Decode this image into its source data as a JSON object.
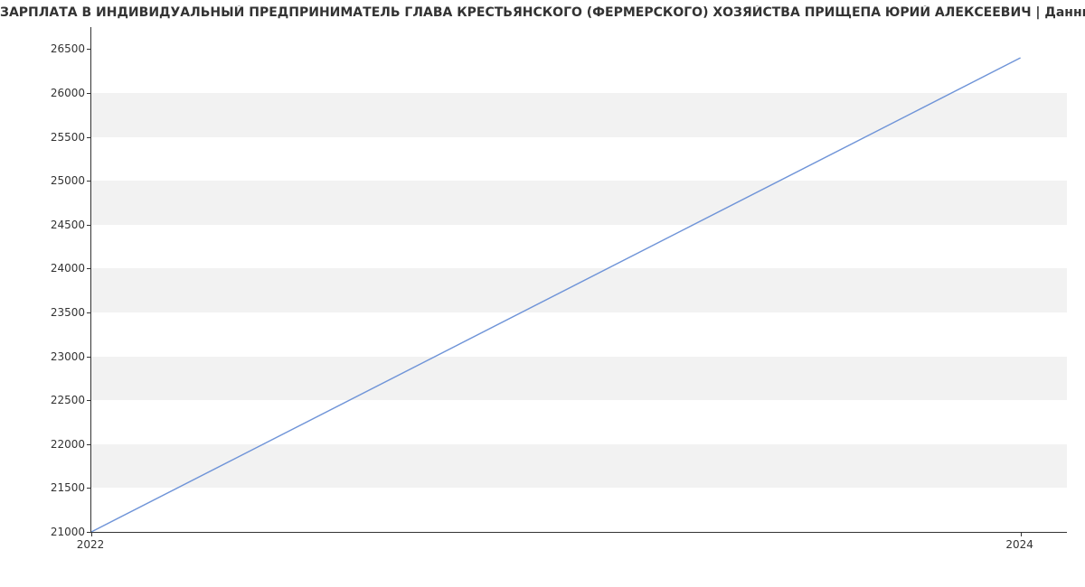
{
  "chart_data": {
    "type": "line",
    "title": "ЗАРПЛАТА В ИНДИВИДУАЛЬНЫЙ ПРЕДПРИНИМАТЕЛЬ  ГЛАВА КРЕСТЬЯНСКОГО (ФЕРМЕРСКОГО) ХОЗЯЙСТВА ПРИЩЕПА ЮРИЙ АЛЕКСЕЕВИЧ | Данные mnogo.work",
    "x": [
      2022,
      2024
    ],
    "values": [
      21000,
      26400
    ],
    "x_ticks": [
      2022,
      2024
    ],
    "y_ticks": [
      21000,
      21500,
      22000,
      22500,
      23000,
      23500,
      24000,
      24500,
      25000,
      25500,
      26000,
      26500
    ],
    "ylim": [
      21000,
      26750
    ],
    "xlim": [
      2022,
      2024.1
    ],
    "line_color": "#6f94d8",
    "band_color": "#f2f2f2"
  }
}
